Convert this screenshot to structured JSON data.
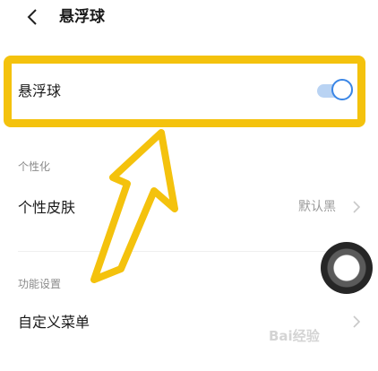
{
  "header": {
    "title": "悬浮球",
    "back_icon": "chevron-left-icon"
  },
  "float_ball_row": {
    "label": "悬浮球",
    "toggle_on": true
  },
  "sections": {
    "personalization": {
      "title": "个性化",
      "skin": {
        "label": "个性皮肤",
        "value": "默认黑"
      }
    },
    "function_settings": {
      "title": "功能设置",
      "custom_menu": {
        "label": "自定义菜单"
      }
    }
  },
  "watermark": "Bai经验",
  "colors": {
    "highlight": "#f4c20d",
    "toggle_accent": "#3a86e6"
  }
}
